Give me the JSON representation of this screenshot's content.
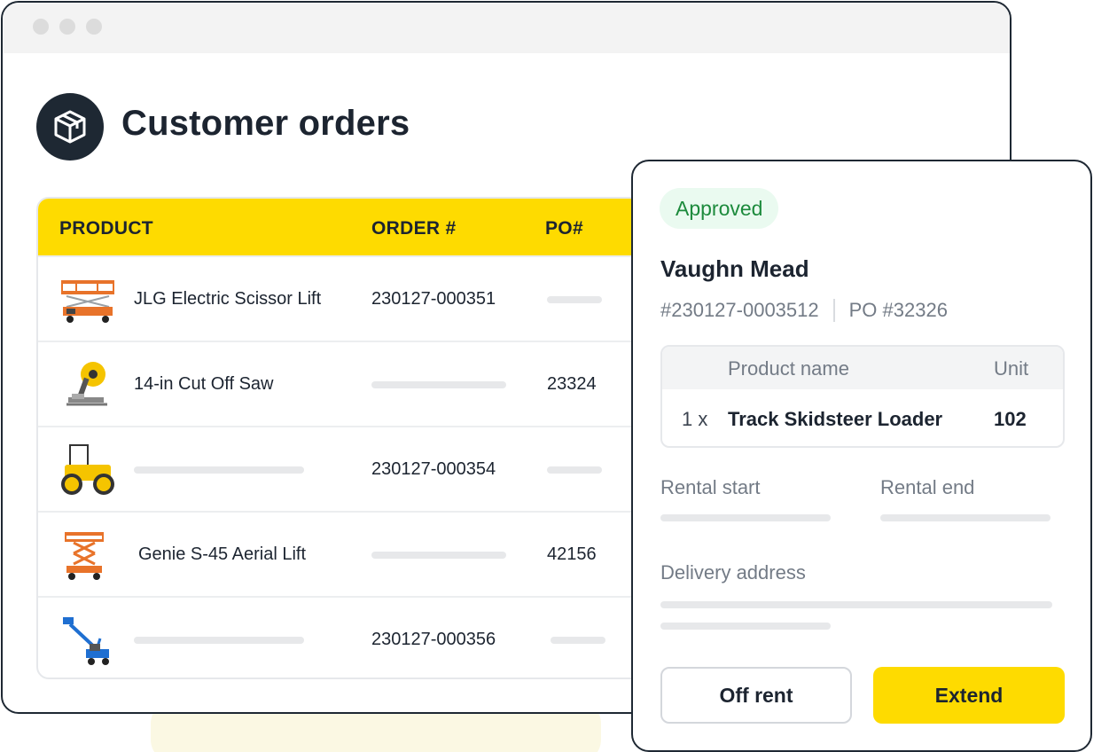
{
  "window": {
    "title": "Customer orders"
  },
  "table": {
    "headers": [
      "PRODUCT",
      "ORDER #",
      "PO#"
    ],
    "rows": [
      {
        "product": "JLG Electric Scissor Lift",
        "order": "230127-000351",
        "po": "",
        "image": "scissor-lift-icon"
      },
      {
        "product": "14-in Cut Off Saw",
        "order": "",
        "po": "23324",
        "image": "cut-off-saw-icon"
      },
      {
        "product": "",
        "order": "230127-000354",
        "po": "",
        "image": "roller-compactor-icon"
      },
      {
        "product": "Genie S-45 Aerial Lift",
        "order": "",
        "po": "42156",
        "image": "aerial-lift-icon"
      },
      {
        "product": "",
        "order": "230127-000356",
        "po": "",
        "image": "boom-lift-icon"
      }
    ]
  },
  "panel": {
    "status": "Approved",
    "customer": "Vaughn Mead",
    "order_number": "#230127-0003512",
    "po_number": "PO #32326",
    "product_table": {
      "col_name": "Product name",
      "col_unit": "Unit",
      "qty": "1 x",
      "name": "Track Skidsteer Loader",
      "unit": "102"
    },
    "rental_start_label": "Rental start",
    "rental_end_label": "Rental end",
    "delivery_label": "Delivery address",
    "off_rent_label": "Off rent",
    "extend_label": "Extend"
  },
  "colors": {
    "accent": "#fedb00",
    "dark": "#1e2833",
    "approved_bg": "#eafaf0",
    "approved_text": "#1c8a3c"
  }
}
